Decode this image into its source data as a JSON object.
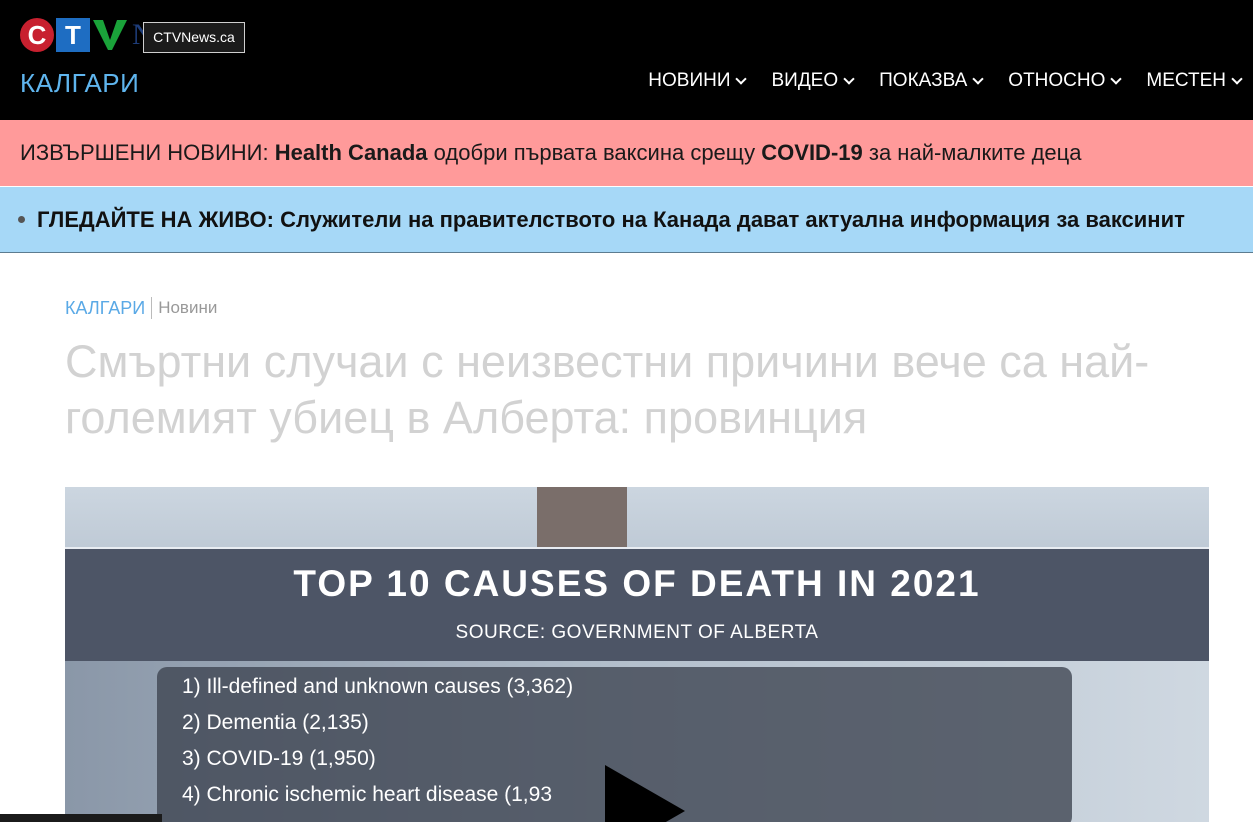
{
  "header": {
    "logo": {
      "c": "C",
      "t": "T",
      "v": "V",
      "n": "N"
    },
    "tooltip": "CTVNews.ca",
    "city": "КАЛГАРИ",
    "nav": [
      {
        "label": "НОВИНИ"
      },
      {
        "label": "ВИДЕО"
      },
      {
        "label": "ПОКАЗВА"
      },
      {
        "label": "ОТНОСНО"
      },
      {
        "label": "МЕСТЕН"
      }
    ],
    "colors": {
      "background": "#000000",
      "city": "#5fb5ee"
    }
  },
  "breaking": {
    "prefix": "ИЗВЪРШЕНИ НОВИНИ:",
    "bold1": "Health Canada",
    "text1": "одобри първата ваксина срещу",
    "bold2": "COVID-19",
    "text2": "за най-малките деца",
    "color": "#ff9a9a"
  },
  "live": {
    "label": "ГЛЕДАЙТЕ НА ЖИВО:",
    "text": "Служители на правителството на Канада дават актуална информация за ваксинит",
    "color": "#a6d8f7"
  },
  "breadcrumb": {
    "city": "КАЛГАРИ",
    "section": "Новини"
  },
  "headline": "Смъртни случаи с неизвестни причини вече са най-големият убиец в Алберта: провинция",
  "video": {
    "title": "TOP 10 CAUSES OF DEATH IN 2021",
    "source": "SOURCE: GOVERNMENT OF ALBERTA",
    "items": [
      "1) Ill-defined and unknown causes (3,362)",
      "2) Dementia (2,135)",
      "3) COVID-19 (1,950)",
      "4) Chronic ischemic heart disease (1,93"
    ],
    "play_icon": "play-icon"
  }
}
